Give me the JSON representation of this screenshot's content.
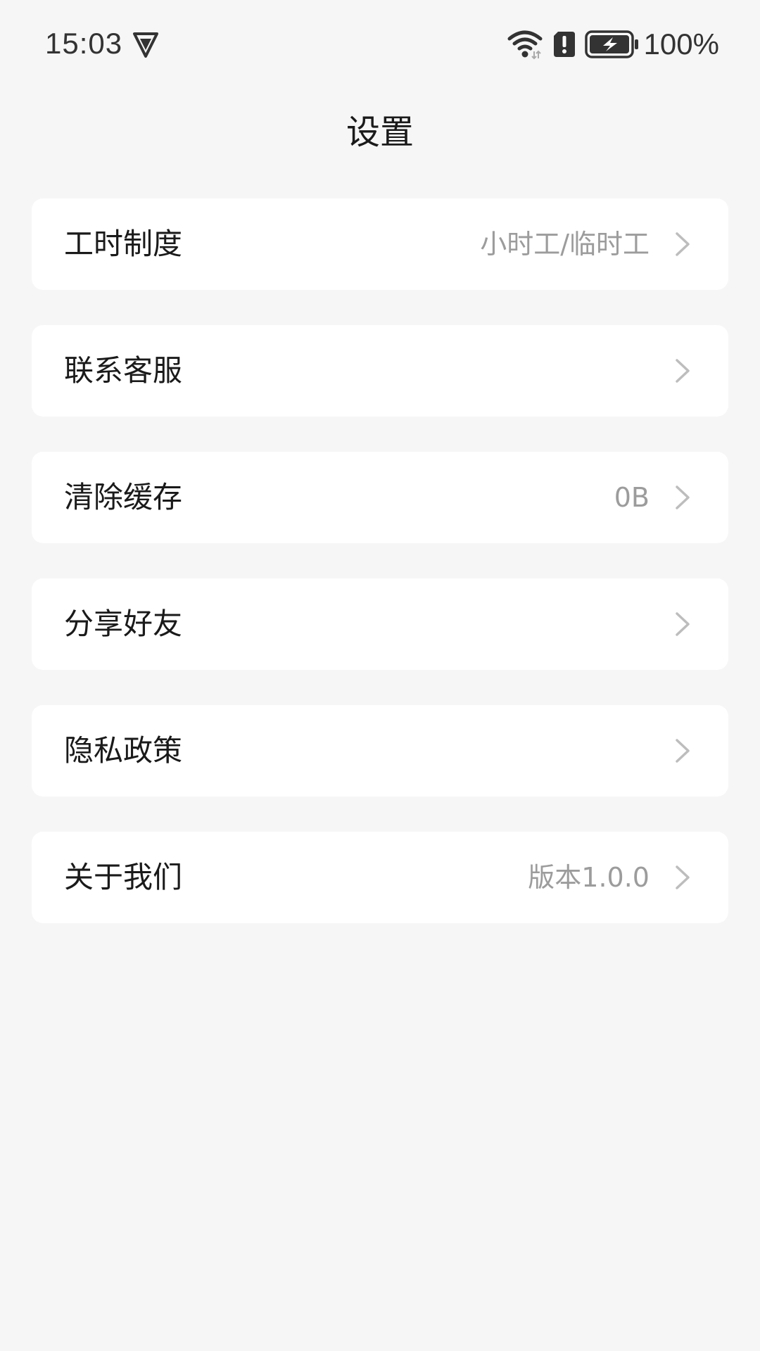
{
  "status_bar": {
    "time": "15:03",
    "battery_text": "100%",
    "icons": [
      "vpn-shield-icon",
      "wifi-icon",
      "alert-icon",
      "battery-charging-icon"
    ]
  },
  "header": {
    "title": "设置"
  },
  "settings": {
    "items": [
      {
        "label": "工时制度",
        "value": "小时工/临时工"
      },
      {
        "label": "联系客服",
        "value": ""
      },
      {
        "label": "清除缓存",
        "value": "0B"
      },
      {
        "label": "分享好友",
        "value": ""
      },
      {
        "label": "隐私政策",
        "value": ""
      },
      {
        "label": "关于我们",
        "value": "版本1.0.0"
      }
    ]
  },
  "colors": {
    "background": "#f6f6f6",
    "card": "#ffffff",
    "text_primary": "#1a1a1a",
    "text_secondary": "#9c9c9c",
    "chevron": "#bdbdbd"
  }
}
